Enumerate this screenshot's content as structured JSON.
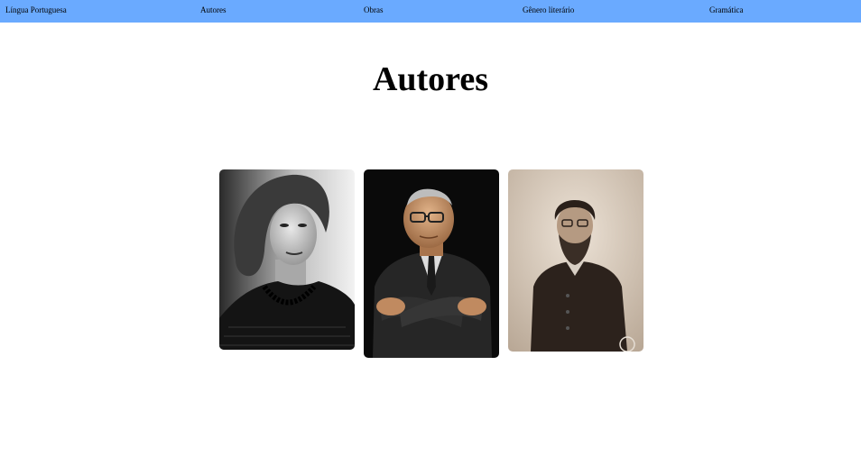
{
  "nav": {
    "items": [
      {
        "label": "Língua Portuguesa"
      },
      {
        "label": "Autores"
      },
      {
        "label": "Obras"
      },
      {
        "label": "Gênero literário"
      },
      {
        "label": "Gramática"
      }
    ],
    "background": "#6aaaff"
  },
  "page": {
    "title": "Autores"
  },
  "authors": [
    {
      "portrait": "woman-portrait-bw"
    },
    {
      "portrait": "man-glasses-portrait"
    },
    {
      "portrait": "bearded-man-portrait-sepia"
    }
  ]
}
